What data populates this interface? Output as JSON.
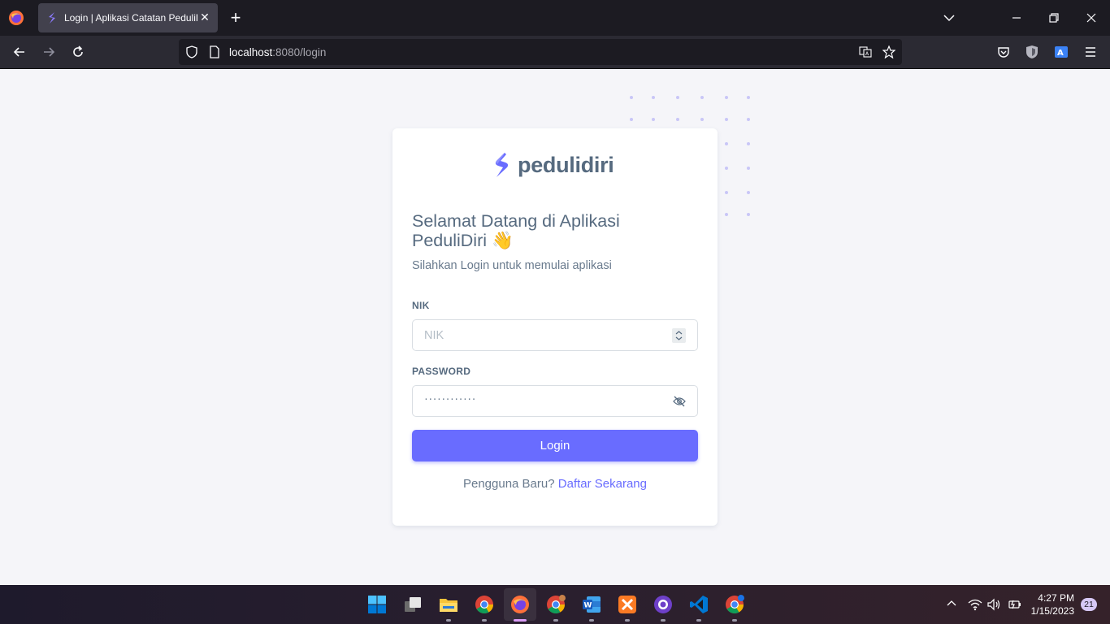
{
  "browser": {
    "tab_title": "Login | Aplikasi Catatan PeduliDiri",
    "url_host": "localhost",
    "url_rest": ":8080/login"
  },
  "page": {
    "brand_name": "pedulidiri",
    "welcome_title": "Selamat Datang di Aplikasi PeduliDiri 👋",
    "subtitle": "Silahkan Login untuk memulai aplikasi",
    "nik_label": "NIK",
    "nik_placeholder": "NIK",
    "password_label": "PASSWORD",
    "password_mask": "············",
    "login_button": "Login",
    "register_prompt": "Pengguna Baru?",
    "register_link": "Daftar Sekarang",
    "accent_color": "#696cff"
  },
  "taskbar": {
    "time": "4:27 PM",
    "date": "1/15/2023",
    "notification_count": "21",
    "apps": [
      "windows-start-icon",
      "task-view-icon",
      "file-explorer-icon",
      "chrome-icon",
      "firefox-icon",
      "chrome-profile-icon",
      "word-icon",
      "xampp-icon",
      "github-desktop-icon",
      "vscode-icon",
      "chrome-dev-icon"
    ]
  }
}
